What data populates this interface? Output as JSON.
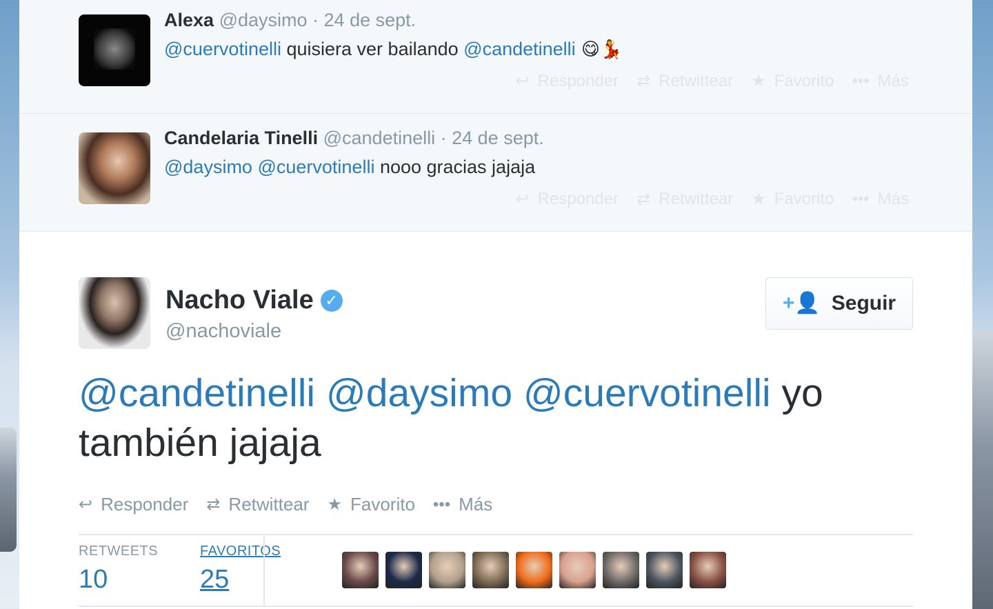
{
  "replies": [
    {
      "name": "Alexa",
      "handle": "@daysimo",
      "date": "· 24 de sept.",
      "text_parts": [
        "@cuervotinelli",
        " quisiera ver bailando ",
        "@candetinelli",
        " 😋💃"
      ]
    },
    {
      "name": "Candelaria Tinelli",
      "handle": "@candetinelli",
      "date": "· 24 de sept.",
      "text_parts": [
        "@daysimo",
        " ",
        "@cuervotinelli",
        " nooo gracias jajaja"
      ]
    }
  ],
  "reply_actions": {
    "reply": "Responder",
    "retweet": "Retwittear",
    "favorite": "Favorito",
    "more": "Más"
  },
  "main": {
    "name": "Nacho Viale",
    "handle": "@nachoviale",
    "follow_label": "Seguir",
    "text_parts": [
      "@candetinelli",
      " ",
      "@daysimo",
      " ",
      "@cuervotinelli",
      " yo también jajaja"
    ],
    "actions": {
      "reply": "Responder",
      "retweet": "Retwittear",
      "favorite": "Favorito",
      "more": "Más"
    },
    "stats": {
      "retweets_label": "RETWEETS",
      "retweets_value": "10",
      "favorites_label": "FAVORITOS",
      "favorites_value": "25"
    },
    "favoriter_colors": [
      "#6b4a4a",
      "#1c2a4a",
      "#b3a08d",
      "#7d6a55",
      "#ef6c1a",
      "#d9a08f",
      "#6e6a68",
      "#4d5560",
      "#8a5045"
    ]
  },
  "icons": {
    "reply": "reply-icon",
    "retweet": "retweet-icon",
    "favorite": "star-icon",
    "more": "more-dots-icon",
    "follow": "add-user-icon",
    "verified": "verified-badge-icon"
  }
}
